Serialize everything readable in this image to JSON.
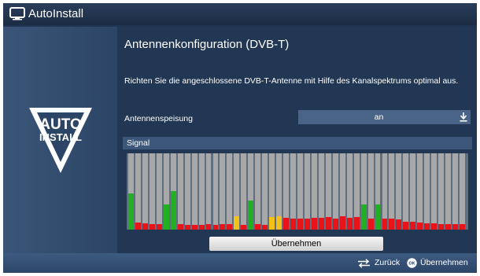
{
  "window": {
    "title": "AutoInstall",
    "title_icon": "tv-icon"
  },
  "sidebar": {
    "logo": {
      "line1": "AUTO",
      "line2": "INSTALL",
      "icon": "autoinstall-triangle-logo"
    }
  },
  "main": {
    "heading": "Antennenkonfiguration (DVB-T)",
    "instruction": "Richten Sie die angeschlossene DVB-T-Antenne mit Hilfe des Kanalspektrums optimal aus.",
    "antenna_power": {
      "label": "Antennenspeisung",
      "value": "an",
      "icon": "dropdown-arrow-icon"
    },
    "signal": {
      "label": "Signal",
      "colors": {
        "strong": "#22b022",
        "medium": "#f2c21a",
        "weak": "#e8141a",
        "empty": "#a8a8a8"
      },
      "channels": [
        {
          "level": 0.47,
          "state": "strong"
        },
        {
          "level": 0.09,
          "state": "weak"
        },
        {
          "level": 0.08,
          "state": "weak"
        },
        {
          "level": 0.07,
          "state": "weak"
        },
        {
          "level": 0.07,
          "state": "weak"
        },
        {
          "level": 0.33,
          "state": "strong"
        },
        {
          "level": 0.51,
          "state": "strong"
        },
        {
          "level": 0.07,
          "state": "weak"
        },
        {
          "level": 0.06,
          "state": "weak"
        },
        {
          "level": 0.06,
          "state": "weak"
        },
        {
          "level": 0.06,
          "state": "weak"
        },
        {
          "level": 0.07,
          "state": "weak"
        },
        {
          "level": 0.06,
          "state": "weak"
        },
        {
          "level": 0.07,
          "state": "weak"
        },
        {
          "level": 0.07,
          "state": "weak"
        },
        {
          "level": 0.18,
          "state": "medium"
        },
        {
          "level": 0.06,
          "state": "weak"
        },
        {
          "level": 0.38,
          "state": "strong"
        },
        {
          "level": 0.07,
          "state": "weak"
        },
        {
          "level": 0.06,
          "state": "weak"
        },
        {
          "level": 0.17,
          "state": "medium"
        },
        {
          "level": 0.18,
          "state": "medium"
        },
        {
          "level": 0.15,
          "state": "weak"
        },
        {
          "level": 0.14,
          "state": "weak"
        },
        {
          "level": 0.14,
          "state": "weak"
        },
        {
          "level": 0.14,
          "state": "weak"
        },
        {
          "level": 0.15,
          "state": "weak"
        },
        {
          "level": 0.15,
          "state": "weak"
        },
        {
          "level": 0.16,
          "state": "weak"
        },
        {
          "level": 0.14,
          "state": "weak"
        },
        {
          "level": 0.18,
          "state": "weak"
        },
        {
          "level": 0.15,
          "state": "weak"
        },
        {
          "level": 0.16,
          "state": "weak"
        },
        {
          "level": 0.33,
          "state": "strong"
        },
        {
          "level": 0.14,
          "state": "weak"
        },
        {
          "level": 0.33,
          "state": "strong"
        },
        {
          "level": 0.14,
          "state": "weak"
        },
        {
          "level": 0.14,
          "state": "weak"
        },
        {
          "level": 0.13,
          "state": "weak"
        },
        {
          "level": 0.1,
          "state": "weak"
        },
        {
          "level": 0.1,
          "state": "weak"
        },
        {
          "level": 0.09,
          "state": "weak"
        },
        {
          "level": 0.08,
          "state": "weak"
        },
        {
          "level": 0.08,
          "state": "weak"
        },
        {
          "level": 0.07,
          "state": "weak"
        },
        {
          "level": 0.07,
          "state": "weak"
        },
        {
          "level": 0.07,
          "state": "weak"
        },
        {
          "level": 0.07,
          "state": "weak"
        }
      ]
    },
    "accept_button": "Übernehmen"
  },
  "footer": {
    "back": {
      "label": "Zurück",
      "icon": "back-arrows-icon"
    },
    "ok": {
      "label": "Übernehmen",
      "icon": "ok-button-icon",
      "icon_text": "OK"
    }
  }
}
